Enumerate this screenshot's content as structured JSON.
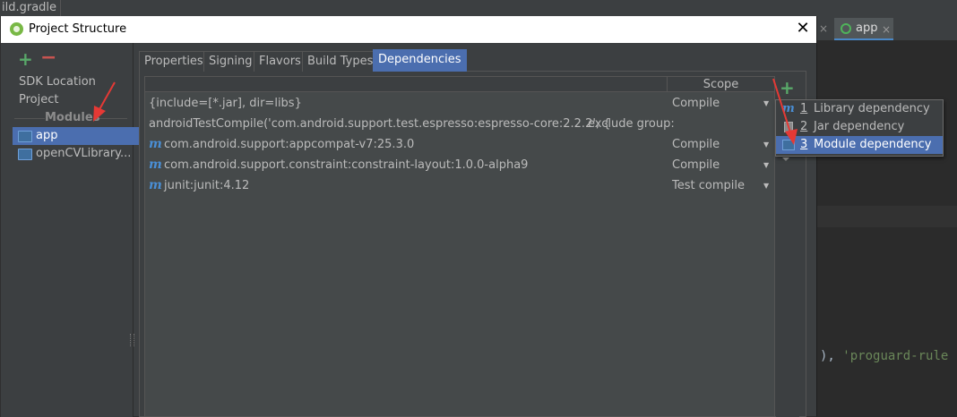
{
  "ide": {
    "breadcrumb": "ild.gradle",
    "editor_tabs": [
      {
        "label": "",
        "close": "×"
      },
      {
        "label": "app",
        "close": "×"
      }
    ],
    "code_line": {
      "prefix": "), ",
      "string": "'proguard-rule"
    }
  },
  "dialog": {
    "title": "Project Structure",
    "close_glyph": "✕",
    "left": {
      "add_glyph": "+",
      "remove_glyph": "−",
      "items": [
        "SDK Location",
        "Project"
      ],
      "section_header": "Modules",
      "modules": [
        "app",
        "openCVLibrary..."
      ],
      "selected_module": "app"
    },
    "tabs": [
      "Properties",
      "Signing",
      "Flavors",
      "Build Types",
      "Dependencies"
    ],
    "active_tab": "Dependencies",
    "dependencies": {
      "columns": [
        "",
        "Scope"
      ],
      "rows": [
        {
          "name": "{include=[*.jar], dir=libs}",
          "scope": "Compile",
          "icon": "",
          "extra": ""
        },
        {
          "name": "androidTestCompile('com.android.support.test.espresso:espresso-core:2.2.2', {",
          "scope": "",
          "icon": "",
          "extra": "exclude group:"
        },
        {
          "name": "com.android.support:appcompat-v7:25.3.0",
          "scope": "Compile",
          "icon": "m",
          "extra": ""
        },
        {
          "name": "com.android.support.constraint:constraint-layout:1.0.0-alpha9",
          "scope": "Compile",
          "icon": "m",
          "extra": ""
        },
        {
          "name": "junit:junit:4.12",
          "scope": "Test compile",
          "icon": "m",
          "extra": ""
        }
      ],
      "add_glyph": "+",
      "dropdown_glyph": "▼"
    },
    "add_menu": {
      "items": [
        {
          "num": "1",
          "label": "Library dependency",
          "icon": "maven-icon"
        },
        {
          "num": "2",
          "label": "Jar dependency",
          "icon": "jar-icon"
        },
        {
          "num": "3",
          "label": "Module dependency",
          "icon": "module-folder-icon"
        }
      ],
      "highlighted": "Module dependency"
    }
  },
  "colors": {
    "selection": "#4b6eaf",
    "annotation_arrow": "#e53935",
    "add_green": "#59a869",
    "remove_red": "#c75450"
  }
}
